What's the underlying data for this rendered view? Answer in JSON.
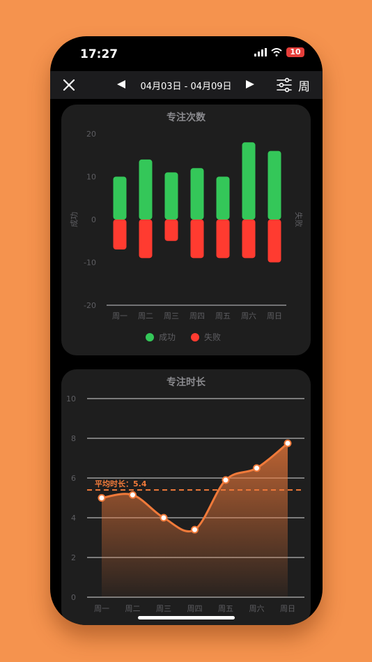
{
  "status_bar": {
    "time": "17:27",
    "battery": "10"
  },
  "nav": {
    "close_icon": "close-icon",
    "prev_icon": "triangle-left-icon",
    "date_range": "04月03日 - 04月09日",
    "next_icon": "triangle-right-icon",
    "filter_icon": "sliders-icon",
    "period": "周"
  },
  "focus_count": {
    "title": "专注次数",
    "chart_data": {
      "type": "bar",
      "title": "专注次数",
      "categories": [
        "周一",
        "周二",
        "周三",
        "周四",
        "周五",
        "周六",
        "周日"
      ],
      "series": [
        {
          "name": "成功",
          "values": [
            10,
            14,
            11,
            12,
            10,
            18,
            16
          ],
          "color": "#34C759"
        },
        {
          "name": "失败",
          "values": [
            -7,
            -9,
            -5,
            -9,
            -9,
            -9,
            -10
          ],
          "color": "#FF3B30"
        }
      ],
      "ylim": [
        -20,
        20
      ],
      "yticks": [
        20,
        10,
        0,
        -10,
        -20
      ],
      "ylabel_left": "成功",
      "ylabel_right": "失败",
      "legend": "bottom"
    }
  },
  "focus_duration": {
    "title": "专注时长",
    "chart_data": {
      "type": "area",
      "title": "专注时长",
      "categories": [
        "周一",
        "周二",
        "周三",
        "周四",
        "周五",
        "周六",
        "周日"
      ],
      "values": [
        5.0,
        5.15,
        4.0,
        3.4,
        5.9,
        6.5,
        7.75
      ],
      "ylim": [
        0,
        10
      ],
      "yticks": [
        0,
        2,
        4,
        6,
        8,
        10
      ],
      "average": 5.4,
      "average_label": "平均时长：5.4",
      "color": "#F07A3A",
      "grid": true
    }
  }
}
